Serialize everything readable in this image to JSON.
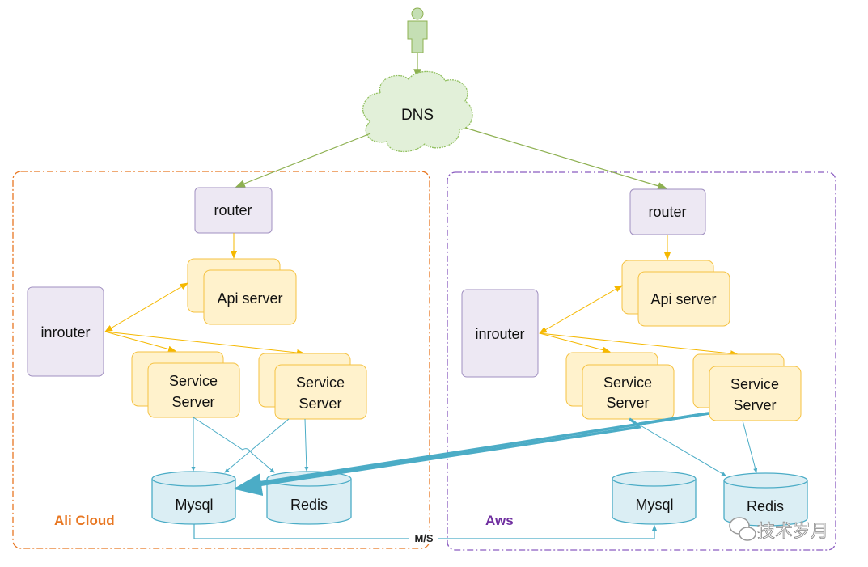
{
  "dns": {
    "label": "DNS"
  },
  "regions": [
    {
      "label": "Ali Cloud",
      "color": "#e87722"
    },
    {
      "label": "Aws",
      "color": "#7030a0"
    }
  ],
  "left": {
    "router": "router",
    "api_server": "Api server",
    "inrouter": "inrouter",
    "service1": [
      "Service",
      "Server"
    ],
    "service2": [
      "Service",
      "Server"
    ],
    "mysql": "Mysql",
    "redis": "Redis"
  },
  "right": {
    "router": "router",
    "api_server": "Api server",
    "inrouter": "inrouter",
    "service1": [
      "Service",
      "Server"
    ],
    "service2": [
      "Service",
      "Server"
    ],
    "mysql": "Mysql",
    "redis": "Redis"
  },
  "replication": {
    "label": "M/S"
  },
  "watermark": {
    "text": "技术岁月"
  },
  "colors": {
    "router_fill": "#ede8f3",
    "router_stroke": "#a08fc0",
    "server_fill": "#fff2cc",
    "server_stroke": "#f5c242",
    "db_fill": "#dbeef4",
    "db_stroke": "#4bacc6",
    "dns_fill": "#e2f0d9",
    "dns_stroke": "#92c060",
    "arrow_yellow": "#f5b800",
    "arrow_green": "#8db050",
    "arrow_blue": "#4bacc6"
  }
}
